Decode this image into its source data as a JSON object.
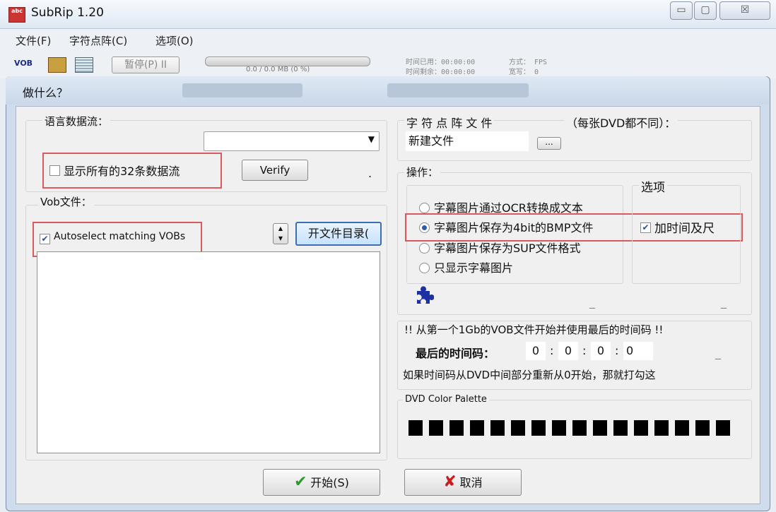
{
  "window": {
    "title": "SubRip 1.20",
    "icon_text": "abc",
    "buttons": {
      "minimize": "▭",
      "maximize": "▢",
      "close": "☒"
    }
  },
  "menu": [
    "文件(F)",
    "字符点阵(C)",
    "选项(O)"
  ],
  "toolbar": {
    "vob_icon": "VOB",
    "pause_label": "暂停(P) II",
    "progress_text": "0.0 / 0.0 MB (0 %)",
    "progress": 0,
    "time_used": "时间已用：00:00:00",
    "time_left": "时间剩余：00:00:00",
    "mode": "方式：  FPS",
    "width": "宽写：  0"
  },
  "dialog": {
    "title": "做什么？",
    "language_stream": {
      "label": "语言数据流：",
      "combo_value": "",
      "show_all_label": "显示所有的32条数据流",
      "show_all_checked": false,
      "verify_label": "Verify",
      "dot": "."
    },
    "vob_files": {
      "label": "Vob文件：",
      "autoselect_label": "Autoselect matching VOBs",
      "autoselect_checked": true,
      "open_dir_label": "开文件目录(",
      "files": []
    },
    "charmatrix": {
      "label": "字 符 点 阵 文 件",
      "note": "（每张DVD都不同）：",
      "file_value": "新建文件",
      "browse_label": "..."
    },
    "operation": {
      "label": "操作：",
      "options": [
        "字幕图片通过OCR转换成文本",
        "字幕图片保存为4bit的BMP文件",
        "字幕图片保存为SUP文件格式",
        "只显示字幕图片"
      ],
      "selected": 1
    },
    "options_group": {
      "label": "选项",
      "add_time_label": "加时间及尺",
      "add_time_checked": true
    },
    "timecode": {
      "notice": "!! 从第一个1Gb的VOB文件开始并使用最后的时间码 !!",
      "last_label": "最后的时间码：",
      "values": [
        "0",
        "0",
        "0",
        "0"
      ],
      "sep_colon": ":",
      "sep_comma": ",",
      "restart_note": "如果时间码从DVD中间部分重新从0开始，那就打勾这"
    },
    "palette": {
      "label": "DVD Color Palette",
      "colors": [
        "#000000",
        "#000000",
        "#000000",
        "#000000",
        "#000000",
        "#000000",
        "#000000",
        "#000000",
        "#000000",
        "#000000",
        "#000000",
        "#000000",
        "#000000",
        "#000000",
        "#000000",
        "#000000"
      ]
    },
    "start_label": "开始(S)",
    "cancel_label": "取消",
    "dashes": [
      "_",
      "_",
      "_",
      "_"
    ]
  },
  "colors": {
    "highlight_box": "#d85a5a",
    "check_green": "#2e9a2e",
    "cancel_red": "#c81e1e",
    "puzzle_blue": "#1c2fa3"
  }
}
